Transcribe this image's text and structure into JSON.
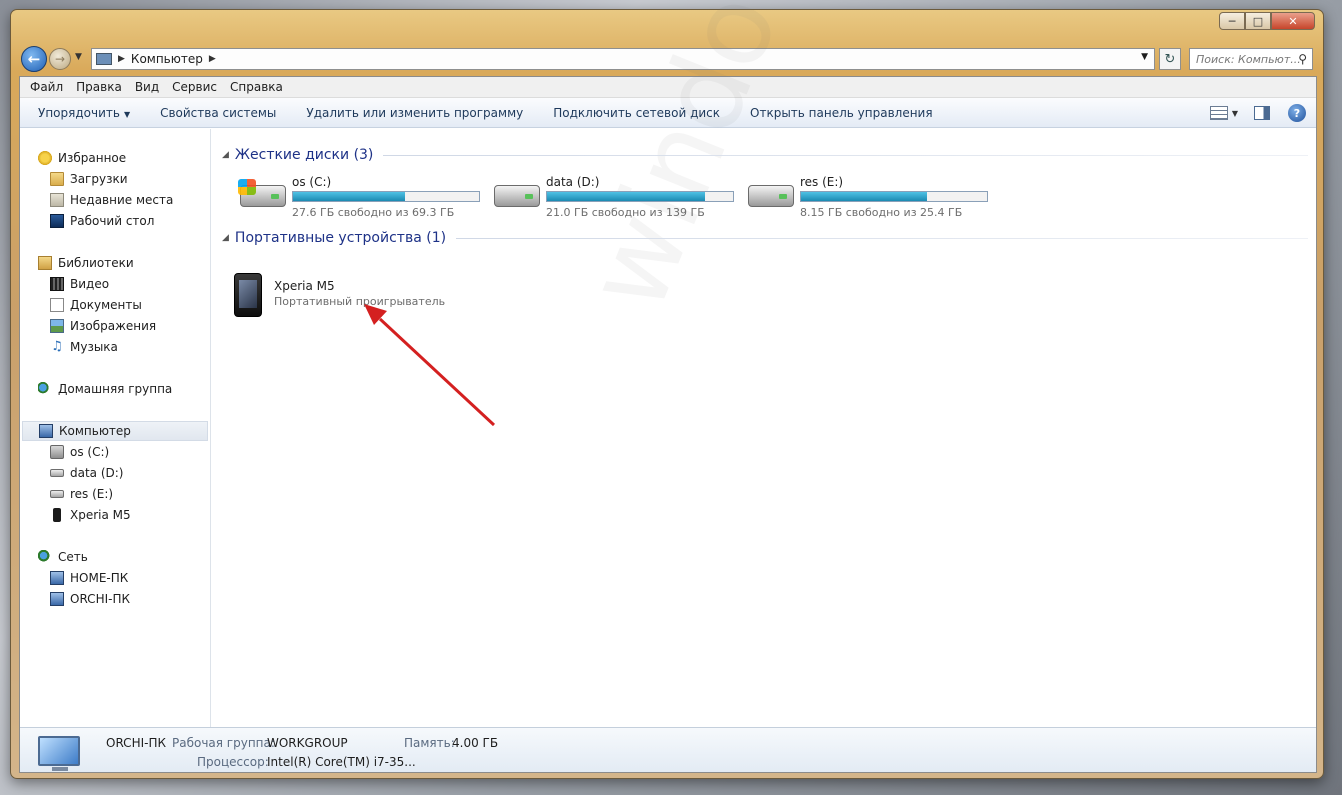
{
  "window": {
    "controls": {
      "minimize": "─",
      "maximize": "□",
      "close": "✕"
    }
  },
  "address": {
    "crumb": "Компьютер",
    "search_placeholder": "Поиск: Компьют..."
  },
  "menu": [
    "Файл",
    "Правка",
    "Вид",
    "Сервис",
    "Справка"
  ],
  "toolbar": {
    "organize": "Упорядочить",
    "system_props": "Свойства системы",
    "uninstall": "Удалить или изменить программу",
    "map_drive": "Подключить сетевой диск",
    "control_panel": "Открыть панель управления"
  },
  "nav": {
    "favorites": "Избранное",
    "downloads": "Загрузки",
    "recent": "Недавние места",
    "desktop": "Рабочий стол",
    "libraries": "Библиотеки",
    "video": "Видео",
    "documents": "Документы",
    "images": "Изображения",
    "music": "Музыка",
    "homegroup": "Домашняя группа",
    "computer": "Компьютер",
    "drive_c": "os (C:)",
    "drive_d": "data (D:)",
    "drive_e": "res (E:)",
    "phone": "Xperia M5",
    "network": "Сеть",
    "net_home": "HOME-ПК",
    "net_orchi": "ORCHI-ПК"
  },
  "groups": {
    "hard_drives": "Жесткие диски (3)",
    "portable": "Портативные устройства (1)"
  },
  "drives": [
    {
      "name": "os (C:)",
      "free_text": "27.6 ГБ свободно из 69.3 ГБ",
      "used_fraction": 0.6
    },
    {
      "name": "data (D:)",
      "free_text": "21.0 ГБ свободно из 139 ГБ",
      "used_fraction": 0.85
    },
    {
      "name": "res (E:)",
      "free_text": "8.15 ГБ свободно из 25.4 ГБ",
      "used_fraction": 0.68
    }
  ],
  "device": {
    "name": "Xperia M5",
    "type": "Портативный проигрыватель"
  },
  "details": {
    "pc_name": "ORCHI-ПК",
    "workgroup_label": "Рабочая группа:",
    "workgroup": "WORKGROUP",
    "memory_label": "Память:",
    "memory": "4.00 ГБ",
    "cpu_label": "Процессор:",
    "cpu": "Intel(R) Core(TM) i7-35..."
  },
  "watermark": "windowstips.ru",
  "colors": {
    "accent_arrow": "#d42020",
    "bar_fill": "#1b8ab2",
    "group_header": "#1e3287"
  }
}
